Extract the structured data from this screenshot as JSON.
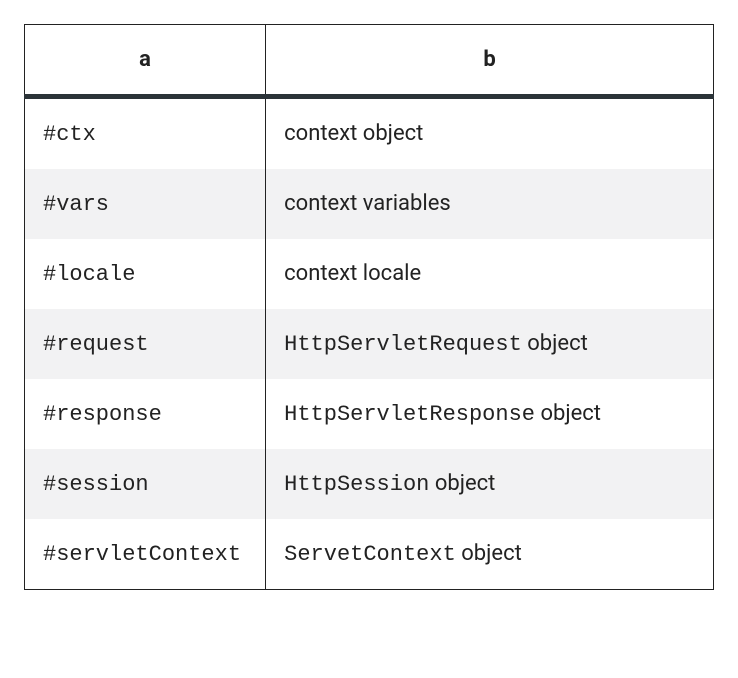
{
  "table": {
    "headers": {
      "a": "a",
      "b": "b"
    },
    "rows": [
      {
        "a": {
          "code": "#ctx"
        },
        "b": {
          "code": "",
          "plain": "context object"
        }
      },
      {
        "a": {
          "code": "#vars"
        },
        "b": {
          "code": "",
          "plain": "context variables"
        }
      },
      {
        "a": {
          "code": "#locale"
        },
        "b": {
          "code": "",
          "plain": "context locale"
        }
      },
      {
        "a": {
          "code": "#request"
        },
        "b": {
          "code": "HttpServletRequest",
          "plain": " object"
        }
      },
      {
        "a": {
          "code": "#response"
        },
        "b": {
          "code": "HttpServletResponse",
          "plain": " object"
        }
      },
      {
        "a": {
          "code": "#session"
        },
        "b": {
          "code": "HttpSession",
          "plain": " object"
        }
      },
      {
        "a": {
          "code": "#servletContext"
        },
        "b": {
          "code": "ServetContext",
          "plain": " object"
        }
      }
    ]
  }
}
